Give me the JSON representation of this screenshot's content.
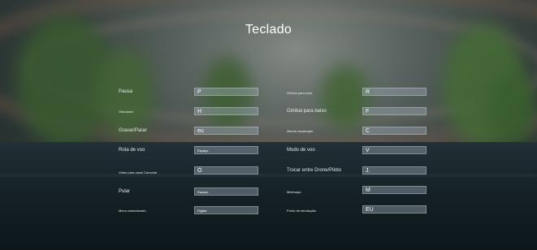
{
  "title": "Teclado",
  "left": [
    {
      "label": "Pausa",
      "key": "P"
    },
    {
      "label": "Obturador",
      "key": "H"
    },
    {
      "label": "Gravar/Parar",
      "key": "eu"
    },
    {
      "label": "Rota de voo",
      "key": "Espaço"
    },
    {
      "label": "Voltar para casa/ Cancelar",
      "key": "Ó"
    },
    {
      "label": "Pular",
      "key": "Espaço"
    },
    {
      "label": "Menu customizado",
      "key": "Digitar"
    }
  ],
  "right": [
    {
      "label": "Gimbal para cima",
      "key": "R"
    },
    {
      "label": "Gimbal para baixo",
      "key": "F"
    },
    {
      "label": "Alternar visualização",
      "key": "C"
    },
    {
      "label": "Modo de voo",
      "key": "V"
    },
    {
      "label": "Trocar entre Drone/Piloto",
      "key": "J."
    },
    {
      "label": "Minimapa",
      "key": "M"
    },
    {
      "label": "Ponto de introdução",
      "key": "EU"
    }
  ]
}
